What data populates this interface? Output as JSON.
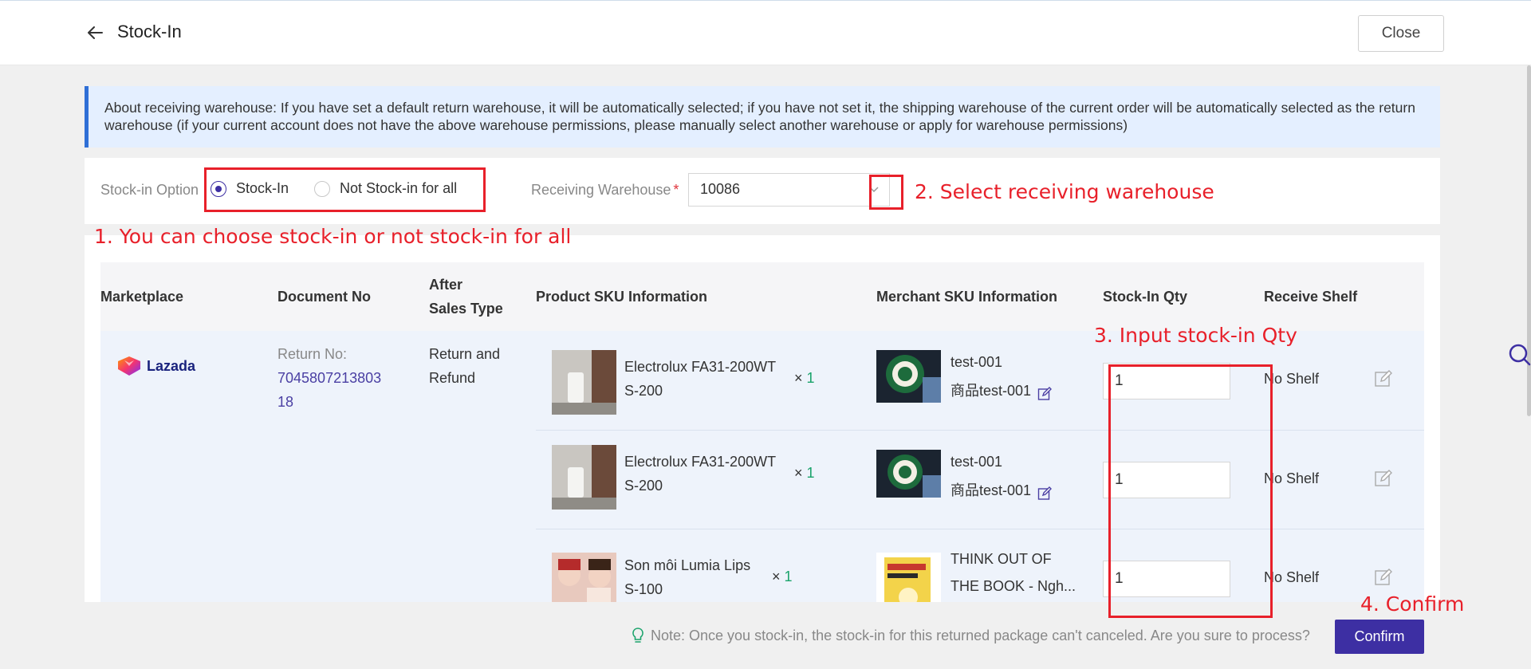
{
  "header": {
    "back_icon": "arrow-left-icon",
    "title": "Stock-In",
    "close_label": "Close"
  },
  "info_banner": {
    "text": "About receiving warehouse: If you have set a default return warehouse, it will be automatically selected; if you have not set it, the shipping warehouse of the current order will be automatically selected as the return warehouse (if your current account does not have the above warehouse permissions, please manually select another warehouse or apply for warehouse permissions)"
  },
  "stock_in_option": {
    "label": "Stock-in Option",
    "options": [
      "Stock-In",
      "Not Stock-in for all"
    ],
    "selected": "Stock-In"
  },
  "receiving_warehouse": {
    "label": "Receiving Warehouse",
    "required_mark": "*",
    "value": "10086"
  },
  "table": {
    "headers": {
      "marketplace": "Marketplace",
      "document_no": "Document No",
      "after_sales_line1": "After",
      "after_sales_line2": "Sales Type",
      "product_sku": "Product SKU Information",
      "merchant_sku": "Merchant SKU Information",
      "stock_in_qty": "Stock-In Qty",
      "receive_shelf": "Receive Shelf"
    },
    "order": {
      "marketplace": "Lazada",
      "return_no_label": "Return No:",
      "return_no_line1": "7045807213803",
      "return_no_line2": "18",
      "after_sales_line1": "Return and",
      "after_sales_line2": "Refund"
    },
    "rows": [
      {
        "product_line1": "Electrolux FA31-200WT",
        "product_line2": "S-200",
        "qty_x": "×",
        "qty": "1",
        "merchant_line1": "test-001",
        "merchant_line2": "商品test-001",
        "stock_in_qty": "1",
        "shelf": "No Shelf"
      },
      {
        "product_line1": "Electrolux FA31-200WT",
        "product_line2": "S-200",
        "qty_x": "×",
        "qty": "1",
        "merchant_line1": "test-001",
        "merchant_line2": "商品test-001",
        "stock_in_qty": "1",
        "shelf": "No Shelf"
      },
      {
        "product_line1": "Son môi Lumia Lips",
        "product_line2": "S-100",
        "qty_x": "×",
        "qty": "1",
        "merchant_line1": "THINK OUT OF",
        "merchant_line2": "THE BOOK - Ngh...",
        "stock_in_qty": "1",
        "shelf": "No Shelf"
      }
    ]
  },
  "footer": {
    "note": "Note: Once you stock-in, the stock-in for this returned package can't canceled. Are you sure to process?",
    "confirm_label": "Confirm"
  },
  "annotations": {
    "step1": "1. You can choose stock-in or not stock-in for all",
    "step2": "2. Select receiving warehouse",
    "step3": "3. Input stock-in Qty",
    "step4": "4. Confirm",
    "color": "#e8202a"
  },
  "colors": {
    "primary": "#3d2fa3",
    "info_bg": "#e4efff",
    "info_border": "#2f6fd6",
    "qty_green": "#1aa36b"
  }
}
